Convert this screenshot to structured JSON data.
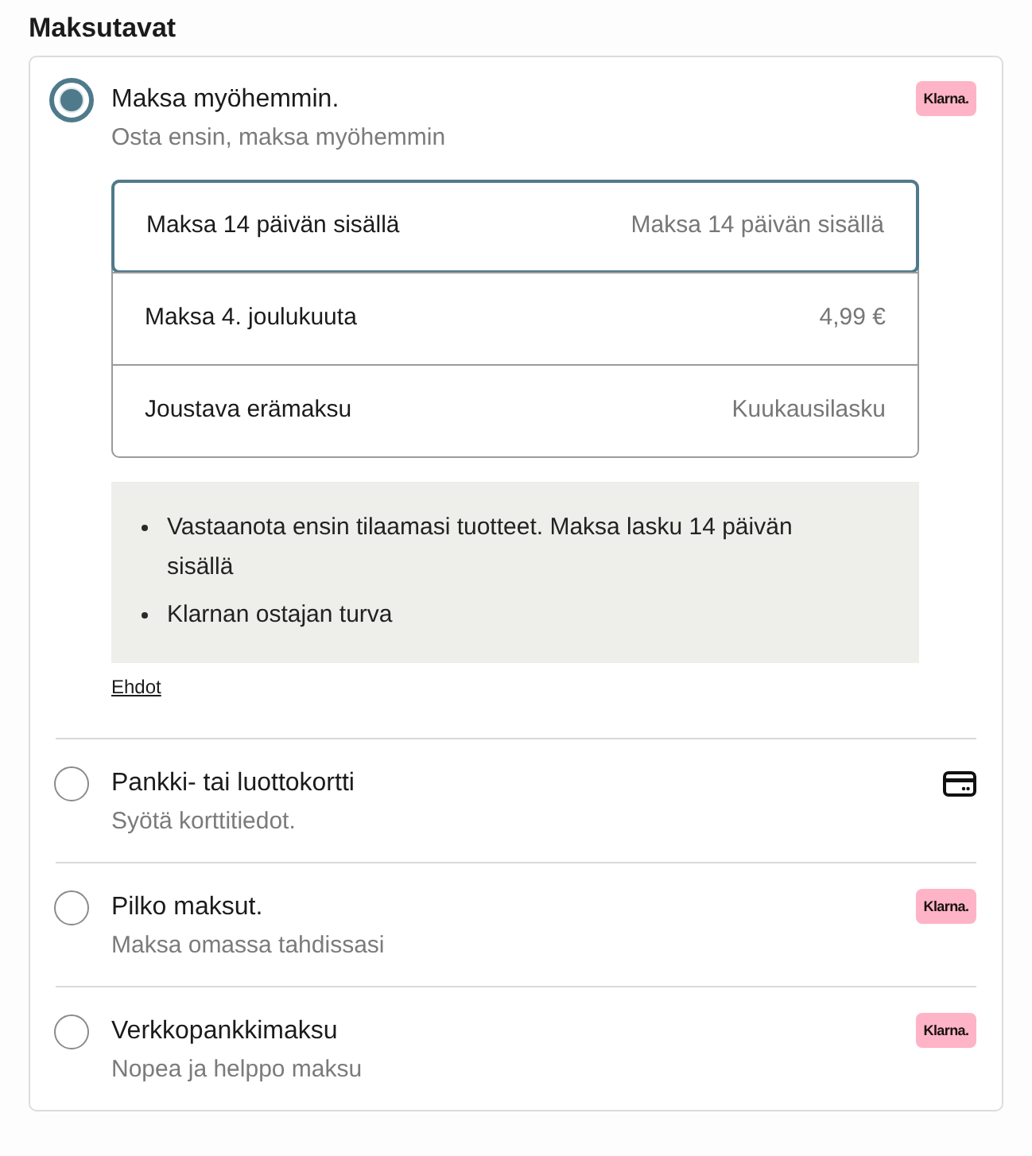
{
  "title": "Maksutavat",
  "methods": [
    {
      "kind": "klarna",
      "selected": true,
      "title": "Maksa myöhemmin.",
      "subtitle": "Osta ensin, maksa myöhemmin",
      "badge": "Klarna.",
      "options": [
        {
          "label": "Maksa 14 päivän sisällä",
          "value": "Maksa 14 päivän sisällä",
          "selected": true
        },
        {
          "label": "Maksa 4. joulukuuta",
          "value": "4,99 €",
          "selected": false
        },
        {
          "label": "Joustava erämaksu",
          "value": "Kuukausilasku",
          "selected": false
        }
      ],
      "info": [
        "Vastaanota ensin tilaamasi tuotteet. Maksa lasku 14 päivän sisällä",
        "Klarnan ostajan turva"
      ],
      "link": "Ehdot"
    },
    {
      "kind": "card",
      "selected": false,
      "title": "Pankki- tai luottokortti",
      "subtitle": "Syötä korttitiedot."
    },
    {
      "kind": "klarna",
      "selected": false,
      "title": "Pilko maksut.",
      "subtitle": "Maksa omassa tahdissasi",
      "badge": "Klarna."
    },
    {
      "kind": "klarna",
      "selected": false,
      "title": "Verkkopankkimaksu",
      "subtitle": "Nopea ja helppo maksu",
      "badge": "Klarna."
    }
  ]
}
